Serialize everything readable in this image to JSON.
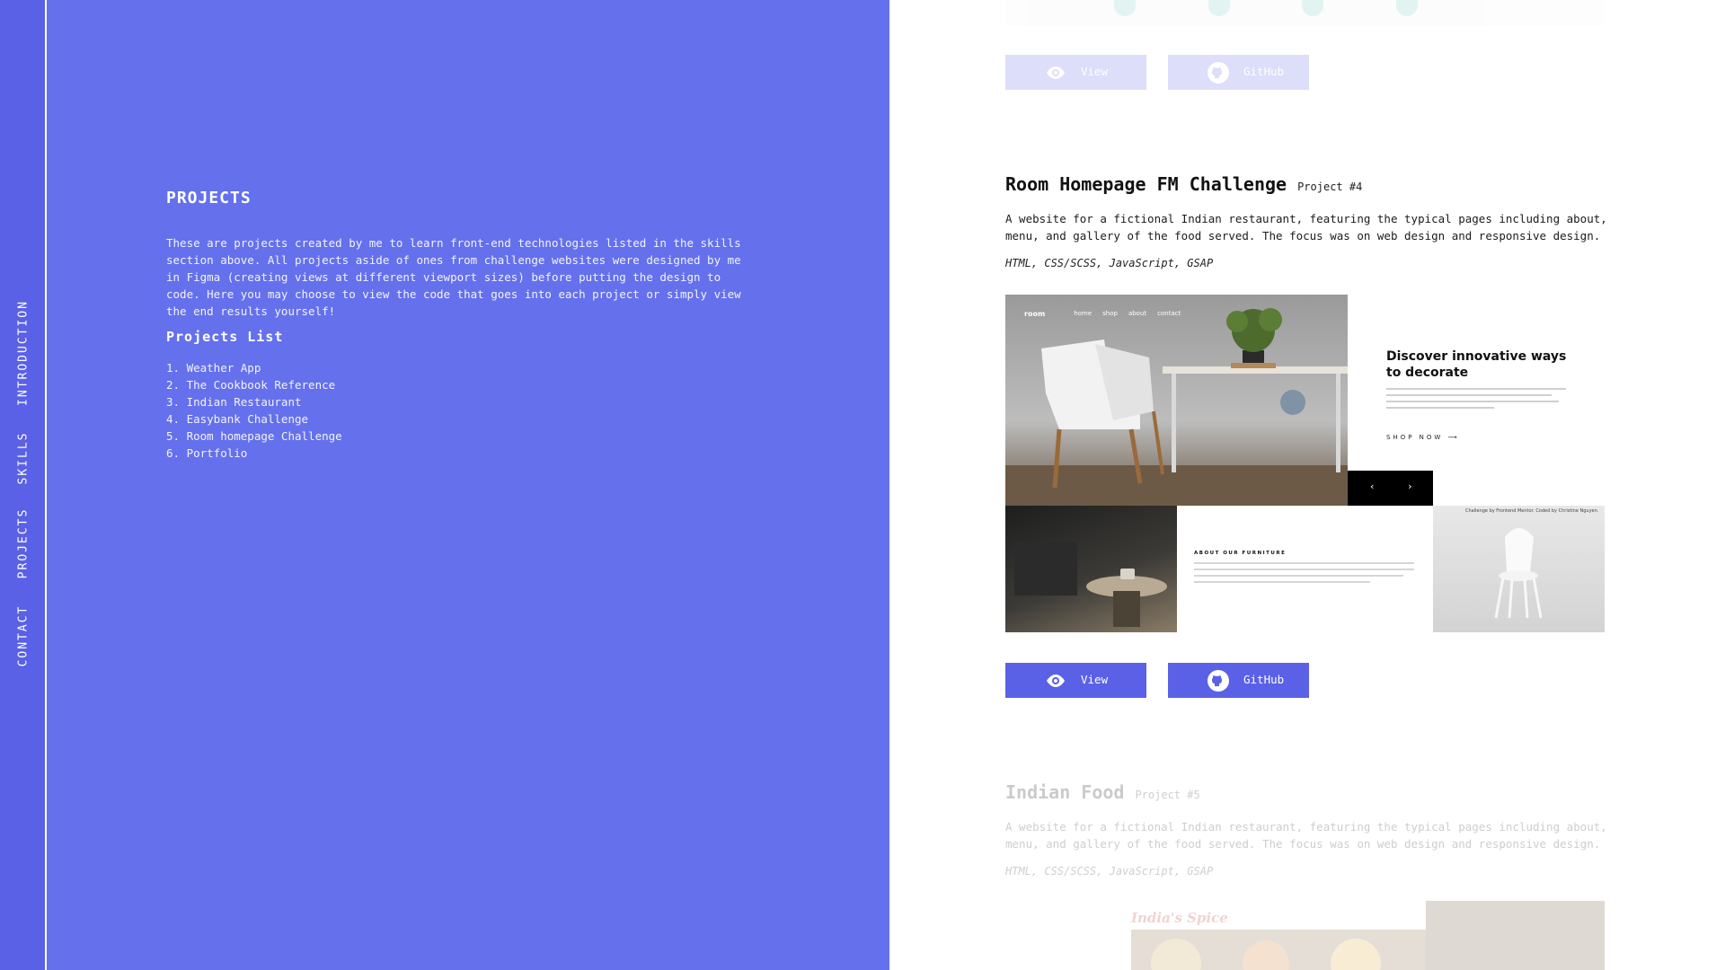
{
  "nav": {
    "items": [
      "INTRODUCTION",
      "SKILLS",
      "PROJECTS",
      "CONTACT"
    ]
  },
  "panel": {
    "title": "PROJECTS",
    "description": "These are projects created by me to learn front-end technologies listed in the skills section above. All projects aside of ones from challenge websites were designed by me in Figma (creating views at different viewport sizes) before putting the design to code. Here you may choose to view the code that goes into each project or simply view the end results yourself!",
    "list_title": "Projects List",
    "list": [
      "1. Weather App",
      "2. The Cookbook Reference",
      "3. Indian Restaurant",
      "4. Easybank Challenge",
      "5. Room homepage Challenge",
      "6. Portfolio"
    ]
  },
  "buttons": {
    "view": "View",
    "github": "GitHub"
  },
  "current_project": {
    "name": "Room Homepage FM Challenge",
    "number": "Project #4",
    "description": "A website for a fictional Indian restaurant, featuring the typical pages including about, menu, and gallery of the food served. The focus was on web design and responsive design.",
    "tech": "HTML, CSS/SCSS, JavaScript, GSAP",
    "mockup": {
      "logo": "room",
      "nav": [
        "home",
        "shop",
        "about",
        "contact"
      ],
      "headline": "Discover innovative ways to decorate",
      "cta": "SHOP NOW ⟶",
      "prev_arrow": "‹",
      "next_arrow": "›",
      "about_title": "ABOUT OUR FURNITURE",
      "credit": "Challenge by Frontend Mentor. Coded by Christine Nguyen."
    }
  },
  "next_project": {
    "name": "Indian Food",
    "number": "Project #5",
    "description": "A website for a fictional Indian restaurant, featuring the typical pages including about, menu, and gallery of the food served. The focus was on web design and responsive design.",
    "tech": "HTML, CSS/SCSS, JavaScript, GSAP",
    "logo": "India's Spice"
  },
  "colors": {
    "accent": "#5a61e6",
    "panel": "#6570ec"
  }
}
